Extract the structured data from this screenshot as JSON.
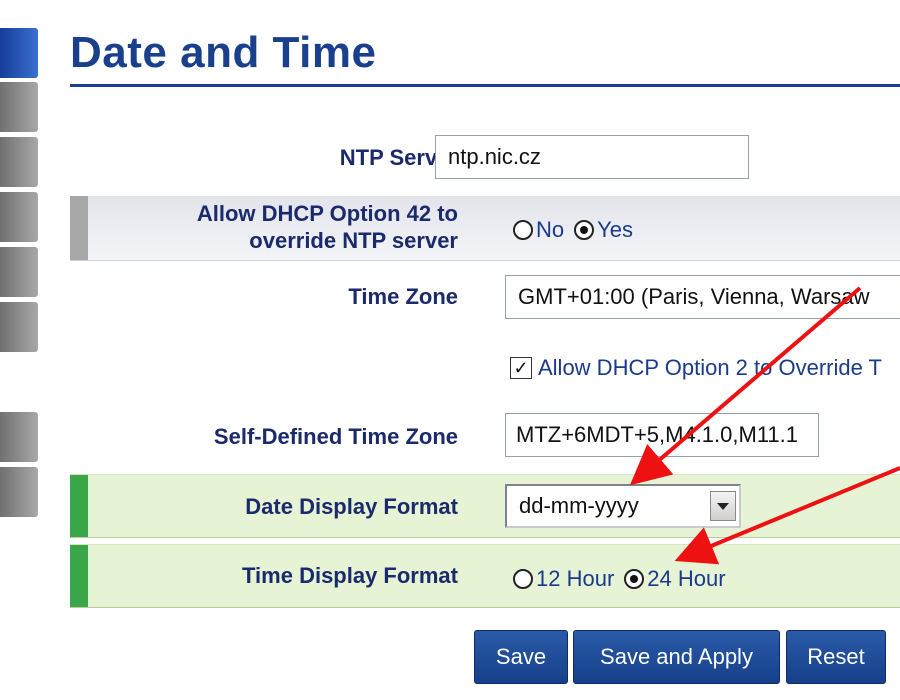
{
  "page": {
    "title": "Date and Time"
  },
  "sidebar": {
    "tab_count": 8,
    "active_tab_index": 0
  },
  "form": {
    "ntp_server": {
      "label": "NTP Server",
      "value": "ntp.nic.cz"
    },
    "dhcp_option_42": {
      "label_line1": "Allow DHCP Option 42 to",
      "label_line2": "override NTP server",
      "options": [
        "No",
        "Yes"
      ],
      "selected": "Yes"
    },
    "time_zone": {
      "label": "Time Zone",
      "value": "GMT+01:00 (Paris, Vienna, Warsaw"
    },
    "dhcp_option_2": {
      "label": "Allow DHCP Option 2 to Override T",
      "checked": true
    },
    "self_defined_tz": {
      "label": "Self-Defined Time Zone",
      "value": "MTZ+6MDT+5,M4.1.0,M11.1"
    },
    "date_format": {
      "label": "Date Display Format",
      "value": "dd-mm-yyyy"
    },
    "time_format": {
      "label": "Time Display Format",
      "options": [
        "12 Hour",
        "24 Hour"
      ],
      "selected": "24 Hour"
    }
  },
  "buttons": {
    "save": "Save",
    "save_apply": "Save and Apply",
    "reset": "Reset"
  },
  "colors": {
    "title": "#1a3f8c",
    "label": "#1a2a6c",
    "button": "#1f4f9e",
    "highlight_row": "#e6f3d4",
    "highlight_marker": "#3aa64a",
    "annotation_arrow": "#ee1111"
  }
}
